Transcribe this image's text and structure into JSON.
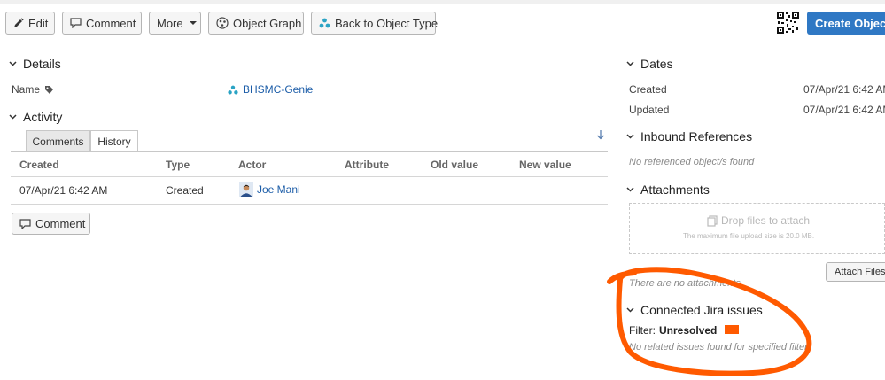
{
  "toolbar": {
    "edit": "Edit",
    "comment": "Comment",
    "more": "More",
    "object_graph": "Object Graph",
    "back_to_object_type": "Back to Object Type",
    "create_object": "Create Object"
  },
  "details": {
    "heading": "Details",
    "name_label": "Name",
    "name_value": "BHSMC-Genie"
  },
  "activity": {
    "heading": "Activity",
    "tabs": [
      "Comments",
      "History"
    ],
    "active_tab": "History",
    "columns": [
      "Created",
      "Type",
      "Actor",
      "Attribute",
      "Old value",
      "New value"
    ],
    "rows": [
      {
        "created": "07/Apr/21 6:42 AM",
        "type": "Created",
        "actor": "Joe Mani",
        "attribute": "",
        "old_value": "",
        "new_value": ""
      }
    ],
    "comment_button": "Comment"
  },
  "dates": {
    "heading": "Dates",
    "created_label": "Created",
    "created_value": "07/Apr/21 6:42 AM",
    "updated_label": "Updated",
    "updated_value": "07/Apr/21 6:42 AM"
  },
  "inbound": {
    "heading": "Inbound References",
    "empty": "No referenced object/s found"
  },
  "attachments": {
    "heading": "Attachments",
    "drop_title": "Drop files to attach",
    "drop_sub": "The maximum file upload size is 20.0 MB.",
    "attach_button": "Attach Files",
    "empty": "There are no attachments"
  },
  "jira": {
    "heading": "Connected Jira issues",
    "filter_label": "Filter:",
    "filter_value": "Unresolved",
    "empty": "No related issues found for specified filter"
  },
  "colors": {
    "primary": "#2f78c4",
    "link": "#1c5da8",
    "annotation": "#ff5a00",
    "object_icon": "#2aa3c4"
  }
}
